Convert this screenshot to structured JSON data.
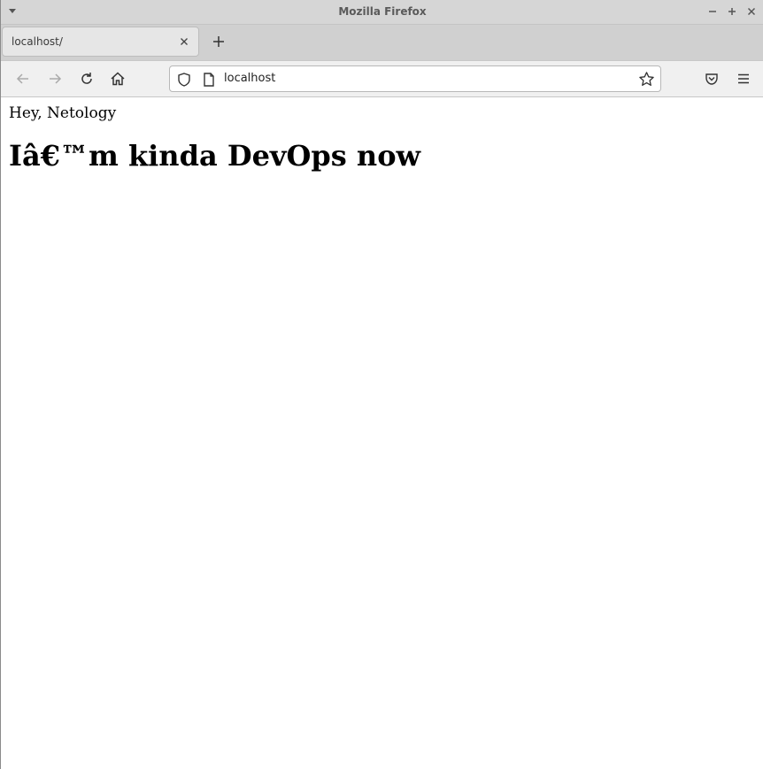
{
  "window": {
    "title": "Mozilla Firefox"
  },
  "tabs": [
    {
      "label": "localhost/",
      "active": true
    }
  ],
  "navbar": {
    "url": "localhost"
  },
  "page": {
    "greeting": "Hey, Netology",
    "heading": "Iâ€™m kinda DevOps now"
  },
  "icons": {
    "window_menu": "chevron-down-icon",
    "minimize": "minimize-icon",
    "maximize": "maximize-icon",
    "close": "close-icon",
    "tab_close": "close-icon",
    "new_tab": "plus-icon",
    "back": "arrow-left-icon",
    "forward": "arrow-right-icon",
    "reload": "reload-icon",
    "home": "home-icon",
    "tracking_protection": "shield-icon",
    "page_info": "document-icon",
    "bookmark": "star-icon",
    "pocket": "pocket-icon",
    "app_menu": "hamburger-menu-icon"
  }
}
